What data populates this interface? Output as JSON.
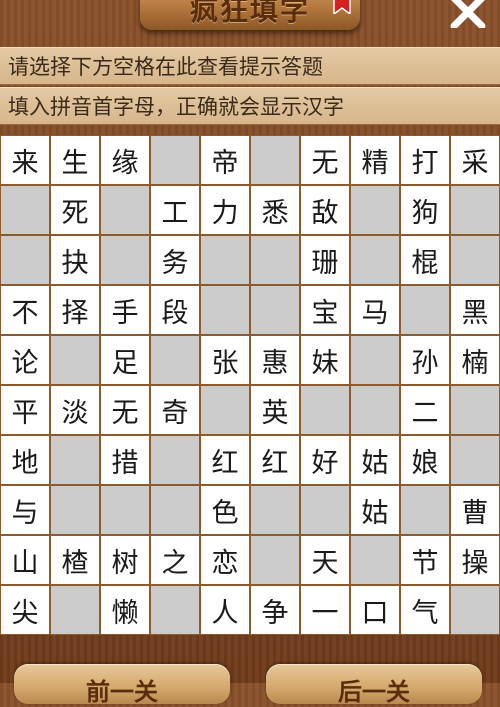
{
  "header": {
    "title": "疯狂填字",
    "close_icon": "close-icon",
    "bookmark_icon": "bookmark-icon"
  },
  "hints": {
    "line1": "请选择下方空格在此查看提示答题",
    "line2": "填入拼音首字母，正确就会显示汉字"
  },
  "colors": {
    "filled_cell": "#ffffff",
    "blank_cell": "#cccccc",
    "grid_line": "#8c5a2c",
    "hint_bar": "#d9b98f"
  },
  "grid": {
    "rows": [
      [
        "来",
        "生",
        "缘",
        "",
        "帝",
        "",
        "无",
        "精",
        "打",
        "采"
      ],
      [
        "",
        "死",
        "",
        "工",
        "力",
        "悉",
        "敌",
        "",
        "狗",
        ""
      ],
      [
        "",
        "抉",
        "",
        "务",
        "",
        "",
        "珊",
        "",
        "棍",
        ""
      ],
      [
        "不",
        "择",
        "手",
        "段",
        "",
        "",
        "宝",
        "马",
        "",
        "黑"
      ],
      [
        "论",
        "",
        "足",
        "",
        "张",
        "惠",
        "妹",
        "",
        "孙",
        "楠"
      ],
      [
        "平",
        "淡",
        "无",
        "奇",
        "",
        "英",
        "",
        "",
        "二",
        ""
      ],
      [
        "地",
        "",
        "措",
        "",
        "红",
        "红",
        "好",
        "姑",
        "娘",
        ""
      ],
      [
        "与",
        "",
        "",
        "",
        "色",
        "",
        "",
        "姑",
        "",
        "曹"
      ],
      [
        "山",
        "楂",
        "树",
        "之",
        "恋",
        "",
        "天",
        "",
        "节",
        "操"
      ],
      [
        "尖",
        "",
        "懒",
        "",
        "人",
        "争",
        "一",
        "口",
        "气",
        ""
      ]
    ]
  },
  "footer": {
    "prev_label": "前一关",
    "next_label": "后一关"
  }
}
